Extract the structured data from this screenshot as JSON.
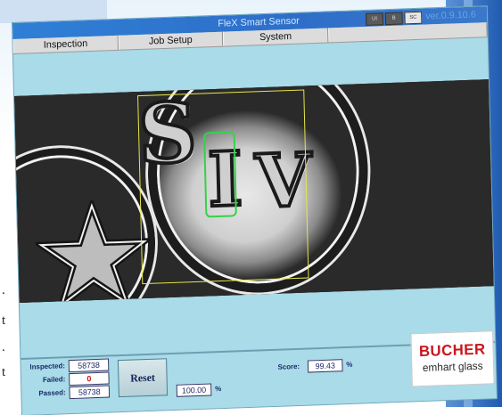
{
  "window": {
    "title": "FleX Smart Sensor",
    "version": "ver.0.9.10.6",
    "title_buttons": [
      "UI",
      "B",
      "SC"
    ]
  },
  "menu": {
    "items": [
      {
        "label": "Inspection"
      },
      {
        "label": "Job Setup"
      },
      {
        "label": "System"
      }
    ]
  },
  "camera": {
    "glyphs": [
      "S",
      "I",
      "V"
    ]
  },
  "stats": {
    "inspected_label": "Inspected:",
    "inspected_value": "58738",
    "failed_label": "Failed:",
    "failed_value": "0",
    "passed_label": "Passed:",
    "passed_value": "58738",
    "reset_label": "Reset",
    "threshold_value": "100.00",
    "threshold_unit": "%",
    "score_label": "Score:",
    "score_value": "99.43",
    "score_unit": "%"
  },
  "logo": {
    "brand": "BUCHER",
    "sub": "emhart glass"
  },
  "side_text": [
    ".",
    "t",
    ".",
    "t"
  ],
  "colors": {
    "title_bar": "#2f7fd6",
    "panel_bg": "#a9dbe8",
    "roi_outer": "#e8e84a",
    "roi_inner": "#35d14a",
    "failed_text": "#d01010",
    "brand_red": "#c8161d"
  }
}
